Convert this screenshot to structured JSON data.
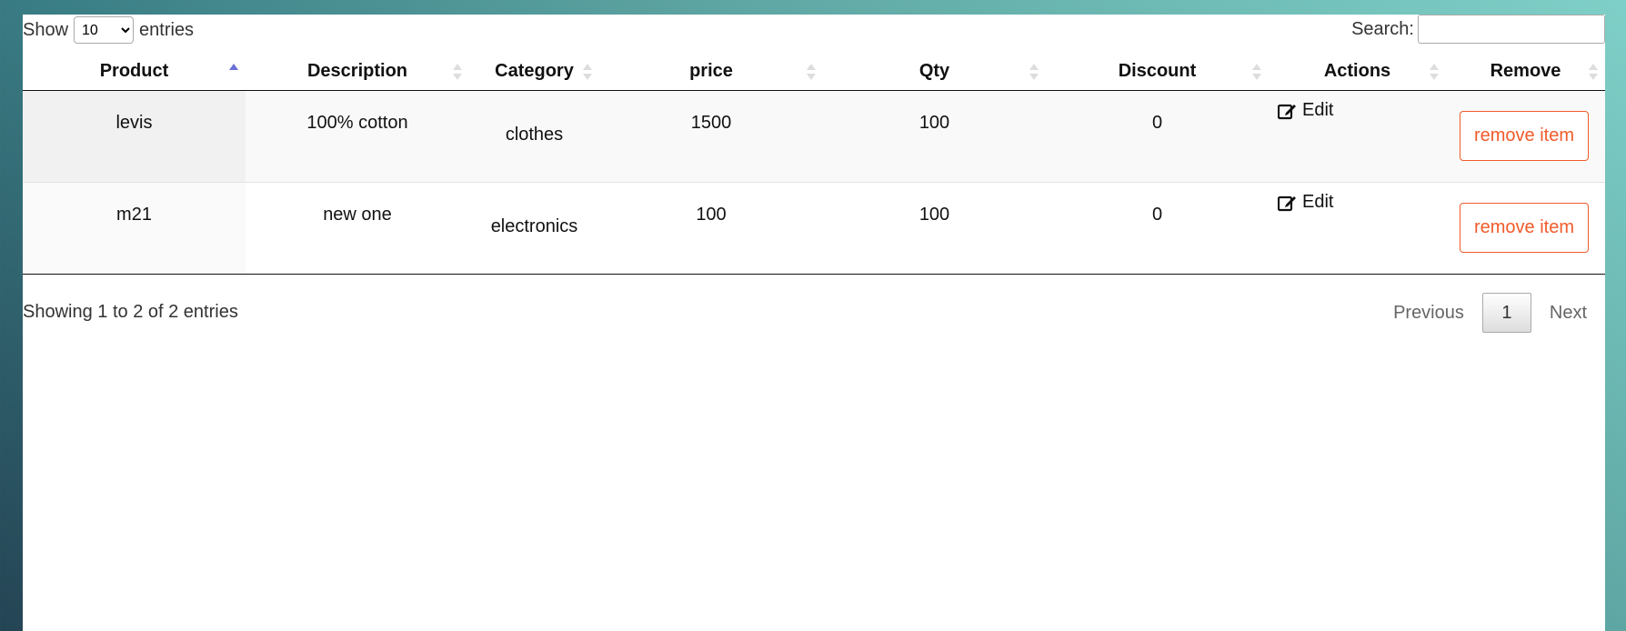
{
  "length": {
    "show": "Show",
    "value": "10",
    "entries": "entries"
  },
  "search": {
    "label": "Search:",
    "value": ""
  },
  "columns": [
    "Product",
    "Description",
    "Category",
    "price",
    "Qty",
    "Discount",
    "Actions",
    "Remove"
  ],
  "rows": [
    {
      "product": "levis",
      "description": "100% cotton",
      "category": "clothes",
      "price": "1500",
      "qty": "100",
      "discount": "0",
      "edit": "Edit",
      "remove": "remove item"
    },
    {
      "product": "m21",
      "description": "new one",
      "category": "electronics",
      "price": "100",
      "qty": "100",
      "discount": "0",
      "edit": "Edit",
      "remove": "remove item"
    }
  ],
  "footer": {
    "info": "Showing 1 to 2 of 2 entries",
    "previous": "Previous",
    "page": "1",
    "next": "Next"
  },
  "colors": {
    "remove_accent": "#f15b2a",
    "sort_active": "#6b6fd6"
  }
}
